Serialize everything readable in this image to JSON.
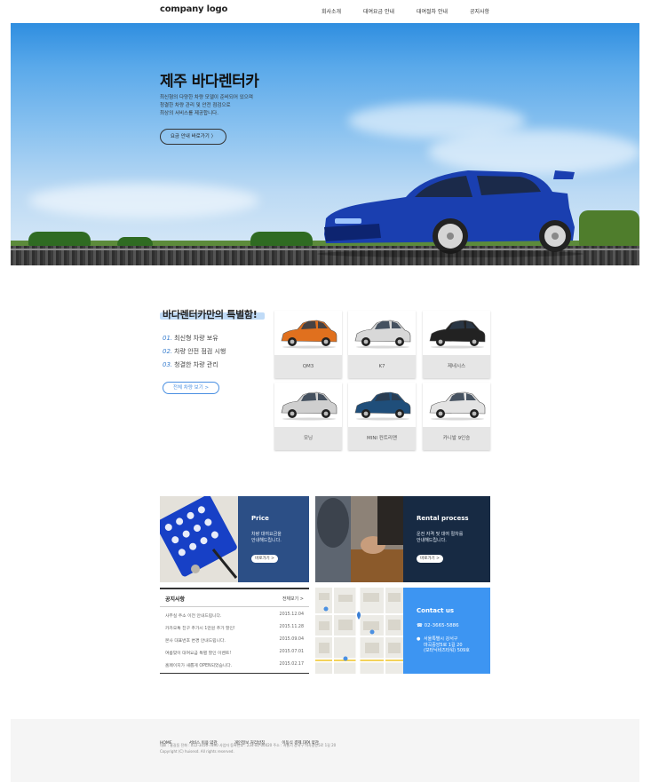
{
  "header": {
    "logo": "company logo",
    "nav": [
      "회사소개",
      "대여요금 안내",
      "대여절차 안내",
      "공지사항"
    ]
  },
  "hero": {
    "title": "제주 바다렌터카",
    "desc": [
      "최신형의 다양한 차량 모델이 준비되어 있으며",
      "청결한 차량 관리 및 안전 점검으로",
      "최상의 서비스를 제공합니다."
    ],
    "button": "요금 안내 바로가기 〉"
  },
  "features": {
    "title": "바다렌터카만의 특별함!",
    "items": [
      {
        "num": "01.",
        "text": "최신형 차량 보유"
      },
      {
        "num": "02.",
        "text": "차량 안전 점검 시행"
      },
      {
        "num": "03.",
        "text": "청결한 차량 관리"
      }
    ],
    "button": "전체 차량 보기 >",
    "cars": [
      {
        "name": "QM3",
        "color": "#e0701e"
      },
      {
        "name": "K7",
        "color": "#d8d8d8"
      },
      {
        "name": "제네시스",
        "color": "#222222"
      },
      {
        "name": "모닝",
        "color": "#cfcfcf"
      },
      {
        "name": "MINI 컨트리맨",
        "color": "#1f4e7a"
      },
      {
        "name": "카니발 9인승",
        "color": "#e3e3e3"
      }
    ]
  },
  "price": {
    "title": "Price",
    "desc": [
      "차량 대여요금을",
      "안내해드립니다."
    ],
    "button": "바로가기 >"
  },
  "rental": {
    "title": "Rental process",
    "desc": [
      "운전 자격 및 대여 절차를",
      "안내해드립니다."
    ],
    "button": "바로가기 >"
  },
  "notice": {
    "title": "공지사항",
    "more": "전체보기 >",
    "rows": [
      {
        "title": "사무실 주소 이전 안내드립니다.",
        "date": "2015.12.04"
      },
      {
        "title": "카카오톡 친구 추가시 1만원 추가 할인!",
        "date": "2015.11.28"
      },
      {
        "title": "본사 대표번호 변경 안내드립니다.",
        "date": "2015.09.04"
      },
      {
        "title": "여름맞이 대여요금 특별 할인 이벤트!",
        "date": "2015.07.01"
      },
      {
        "title": "홈페이지가 새롭게 OPEN되었습니다.",
        "date": "2015.02.17"
      }
    ]
  },
  "contact": {
    "title": "Contact us",
    "phone": "02-3665-5886",
    "address": [
      "서울특별시 강서구",
      "마곡중앙5로 1길 20",
      "(보타닉비즈타워) 509호"
    ]
  },
  "footer": {
    "links": [
      "HOME",
      "서비스 이용 약관",
      "개인정보 처리방침",
      "이동식 결제 대여 약관"
    ],
    "info": "대표 : 홍길동    전화 : 012-3456-7890    사업자 등록번호 : 234-81-00020    주소 : 서울시 강서구 마곡중앙5로 1길 20",
    "copyright": "Copyright (C) huisesd. All rights reserved."
  }
}
